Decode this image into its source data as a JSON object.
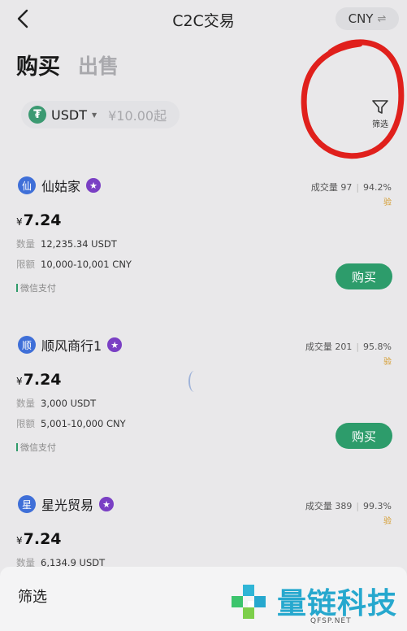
{
  "header": {
    "title": "C2C交易",
    "currency": "CNY",
    "swap_glyph": "⇌"
  },
  "tabs": [
    {
      "label": "购买",
      "active": true
    },
    {
      "label": "出售",
      "active": false
    }
  ],
  "filters": {
    "coin": "USDT",
    "min_amount": "¥10.00起",
    "filter_label": "筛选"
  },
  "listings": [
    {
      "avatar": "仙",
      "name": "仙姑家",
      "volume": "成交量 97",
      "rate": "94.2%",
      "verified": "验",
      "price_symbol": "¥",
      "price": "7.24",
      "qty_label": "数量",
      "qty": "12,235.34 USDT",
      "limit_label": "限额",
      "limit": "10,000-10,001 CNY",
      "payment": "微信支付",
      "buy_label": "购买"
    },
    {
      "avatar": "顺",
      "name": "顺风商行1",
      "volume": "成交量 201",
      "rate": "95.8%",
      "verified": "验",
      "price_symbol": "¥",
      "price": "7.24",
      "qty_label": "数量",
      "qty": "3,000 USDT",
      "limit_label": "限额",
      "limit": "5,001-10,000 CNY",
      "payment": "微信支付",
      "buy_label": "购买"
    },
    {
      "avatar": "星",
      "name": "星光贸易",
      "volume": "成交量 389",
      "rate": "99.3%",
      "verified": "验",
      "price_symbol": "¥",
      "price": "7.24",
      "qty_label": "数量",
      "qty": "6,134.9 USDT"
    }
  ],
  "sheet": {
    "title": "筛选"
  },
  "watermark": {
    "text": "量链科技",
    "sub": "QFSP.NET"
  },
  "colors": {
    "accent": "#2d9c6b",
    "annotation": "#e0201c",
    "watermark": "#26a8ce"
  }
}
